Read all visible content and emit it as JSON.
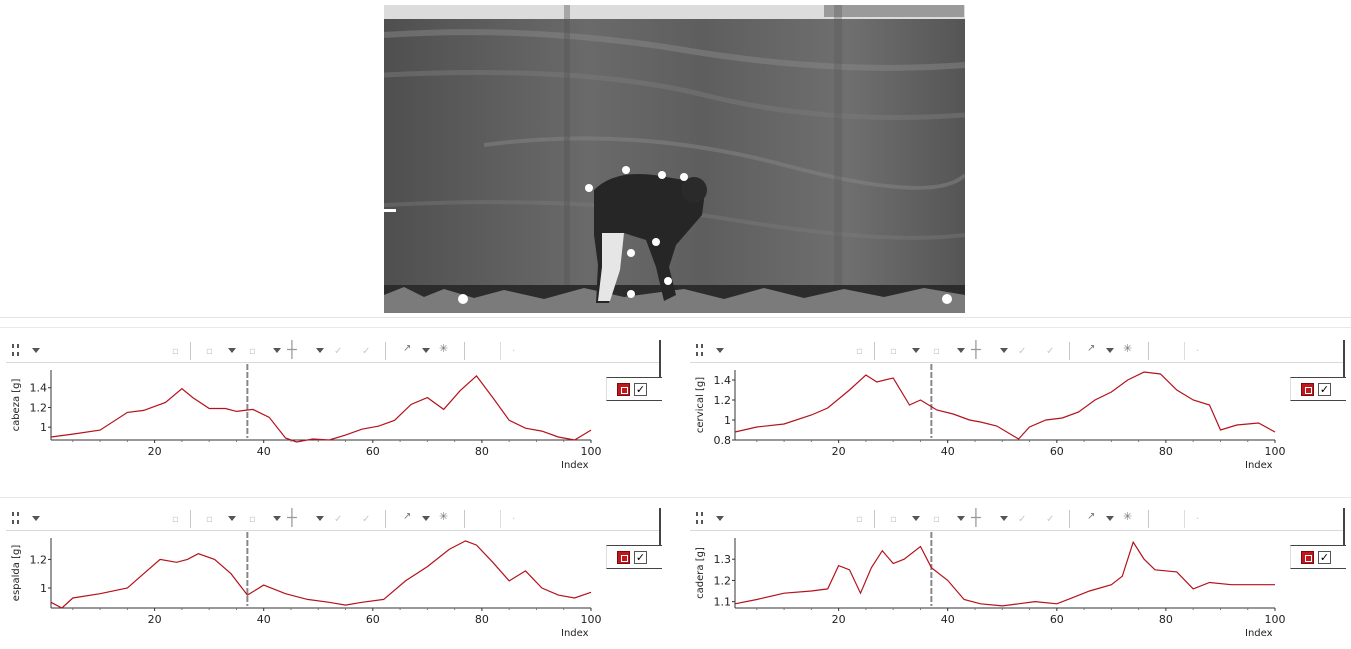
{
  "video": {
    "description_icon": "video-frame-icon"
  },
  "plots": [
    {
      "ylabel": "cabeza [g]",
      "xlabel": "Index",
      "yticks": [
        "1",
        "1.2",
        "1.4"
      ],
      "xticks": [
        "20",
        "40",
        "60",
        "80",
        "100"
      ],
      "cursor_index": 37,
      "checked": "✓",
      "chart_data": {
        "type": "line",
        "xlim": [
          1,
          100
        ],
        "ylim": [
          0.87,
          1.58
        ],
        "ylabel": "cabeza [g]",
        "xlabel": "Index",
        "line_color": "#b5121b",
        "cursor_x": 37,
        "x": [
          1,
          5,
          10,
          15,
          18,
          22,
          25,
          27,
          30,
          33,
          35,
          38,
          41,
          44,
          46,
          49,
          52,
          55,
          58,
          61,
          64,
          67,
          70,
          73,
          76,
          79,
          82,
          85,
          88,
          91,
          94,
          97,
          100
        ],
        "y": [
          0.9,
          0.93,
          0.97,
          1.15,
          1.17,
          1.25,
          1.39,
          1.3,
          1.19,
          1.19,
          1.16,
          1.18,
          1.1,
          0.89,
          0.85,
          0.88,
          0.87,
          0.92,
          0.98,
          1.01,
          1.07,
          1.23,
          1.3,
          1.18,
          1.37,
          1.52,
          1.3,
          1.07,
          0.99,
          0.96,
          0.9,
          0.87,
          0.97
        ]
      }
    },
    {
      "ylabel": "cervical [g]",
      "xlabel": "Index",
      "yticks": [
        "0.8",
        "1",
        "1.2",
        "1.4"
      ],
      "xticks": [
        "20",
        "40",
        "60",
        "80",
        "100"
      ],
      "cursor_index": 37,
      "checked": "✓",
      "chart_data": {
        "type": "line",
        "xlim": [
          1,
          100
        ],
        "ylim": [
          0.8,
          1.5
        ],
        "ylabel": "cervical [g]",
        "xlabel": "Index",
        "line_color": "#b5121b",
        "cursor_x": 37,
        "x": [
          1,
          5,
          10,
          15,
          18,
          22,
          25,
          27,
          30,
          33,
          35,
          38,
          41,
          44,
          46,
          49,
          53,
          55,
          58,
          61,
          64,
          67,
          70,
          73,
          76,
          79,
          82,
          85,
          88,
          90,
          93,
          97,
          100
        ],
        "y": [
          0.88,
          0.93,
          0.96,
          1.05,
          1.12,
          1.3,
          1.45,
          1.38,
          1.42,
          1.15,
          1.2,
          1.1,
          1.06,
          1.0,
          0.98,
          0.94,
          0.81,
          0.93,
          1.0,
          1.02,
          1.08,
          1.2,
          1.28,
          1.4,
          1.48,
          1.46,
          1.3,
          1.2,
          1.15,
          0.9,
          0.95,
          0.97,
          0.88
        ]
      }
    },
    {
      "ylabel": "espalda [g]",
      "xlabel": "Index",
      "yticks": [
        "1",
        "1.2"
      ],
      "xticks": [
        "20",
        "40",
        "60",
        "80",
        "100"
      ],
      "cursor_index": 37,
      "checked": "✓",
      "chart_data": {
        "type": "line",
        "xlim": [
          1,
          100
        ],
        "ylim": [
          0.86,
          1.35
        ],
        "ylabel": "espalda [g]",
        "xlabel": "Index",
        "line_color": "#b5121b",
        "cursor_x": 37,
        "x": [
          1,
          3,
          5,
          10,
          15,
          18,
          21,
          24,
          26,
          28,
          31,
          34,
          37,
          40,
          44,
          48,
          52,
          55,
          58,
          62,
          66,
          70,
          74,
          77,
          79,
          82,
          85,
          88,
          91,
          94,
          97,
          100
        ],
        "y": [
          0.9,
          0.86,
          0.93,
          0.96,
          1.0,
          1.1,
          1.2,
          1.18,
          1.2,
          1.24,
          1.2,
          1.1,
          0.95,
          1.02,
          0.96,
          0.92,
          0.9,
          0.88,
          0.9,
          0.92,
          1.05,
          1.15,
          1.27,
          1.33,
          1.3,
          1.18,
          1.05,
          1.12,
          1.0,
          0.95,
          0.93,
          0.97
        ]
      }
    },
    {
      "ylabel": "cadera [g]",
      "xlabel": "Index",
      "yticks": [
        "1.1",
        "1.2",
        "1.3"
      ],
      "xticks": [
        "20",
        "40",
        "60",
        "80",
        "100"
      ],
      "cursor_index": 37,
      "checked": "✓",
      "chart_data": {
        "type": "line",
        "xlim": [
          1,
          100
        ],
        "ylim": [
          1.07,
          1.4
        ],
        "ylabel": "cadera [g]",
        "xlabel": "Index",
        "line_color": "#b5121b",
        "cursor_x": 37,
        "x": [
          1,
          5,
          10,
          15,
          18,
          20,
          22,
          24,
          26,
          28,
          30,
          32,
          35,
          37,
          40,
          43,
          46,
          50,
          53,
          56,
          60,
          63,
          66,
          70,
          72,
          74,
          76,
          78,
          82,
          85,
          88,
          92,
          96,
          100
        ],
        "y": [
          1.09,
          1.11,
          1.14,
          1.15,
          1.16,
          1.27,
          1.25,
          1.14,
          1.26,
          1.34,
          1.28,
          1.3,
          1.36,
          1.26,
          1.2,
          1.11,
          1.09,
          1.08,
          1.09,
          1.1,
          1.09,
          1.12,
          1.15,
          1.18,
          1.22,
          1.38,
          1.3,
          1.25,
          1.24,
          1.16,
          1.19,
          1.18,
          1.18,
          1.18
        ]
      }
    }
  ]
}
